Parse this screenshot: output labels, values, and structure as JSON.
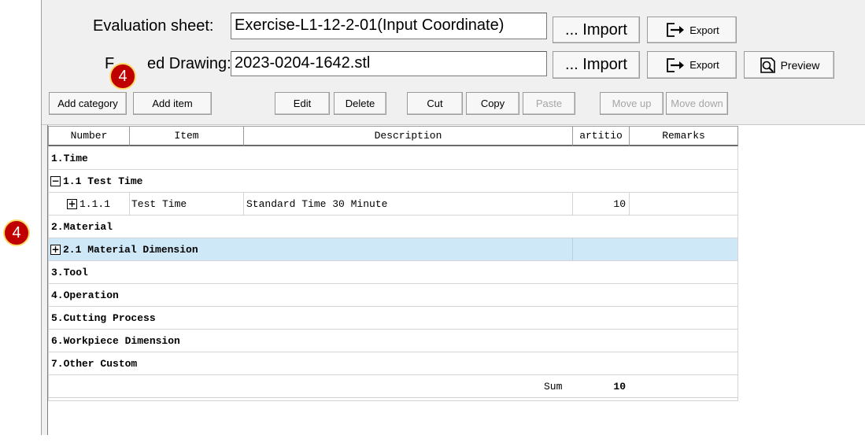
{
  "header": {
    "eval_label": "Evaluation sheet:",
    "eval_value": "Exercise-L1-12-2-01(Input Coordinate)",
    "drawing_label_pre": "F",
    "drawing_label_post": "ed Drawing:",
    "drawing_value": "2023-0204-1642.stl",
    "import_label": "... Import",
    "export_label": "Export",
    "preview_label": "Preview"
  },
  "toolbar": {
    "add_category": "Add category",
    "add_item": "Add item",
    "edit": "Edit",
    "delete": "Delete",
    "cut": "Cut",
    "copy": "Copy",
    "paste": "Paste",
    "move_up": "Move up",
    "move_down": "Move down"
  },
  "grid": {
    "columns": [
      "Number",
      "Item",
      "Description",
      "artitio",
      "Remarks"
    ],
    "rows": [
      {
        "number": "1.Time"
      },
      {
        "toggle": "−",
        "number": "1.1 Test Time"
      },
      {
        "toggle": "+",
        "number": "1.1.1",
        "item": "Test Time",
        "description": "Standard Time 30 Minute",
        "partition": "10",
        "remarks": ""
      },
      {
        "number": "2.Material"
      },
      {
        "toggle": "+",
        "number": "2.1 Material Dimension"
      },
      {
        "number": "3.Tool"
      },
      {
        "number": "4.Operation"
      },
      {
        "number": "5.Cutting Process"
      },
      {
        "number": "6.Workpiece Dimension"
      },
      {
        "number": "7.Other Custom"
      }
    ],
    "sum_label": "Sum",
    "sum_value": "10"
  },
  "annotations": {
    "badge_top": "4",
    "badge_left": "4"
  },
  "colors": {
    "badge": "#c00000",
    "badge_border": "#ffd966",
    "selected_row": "#cfe8f7"
  }
}
